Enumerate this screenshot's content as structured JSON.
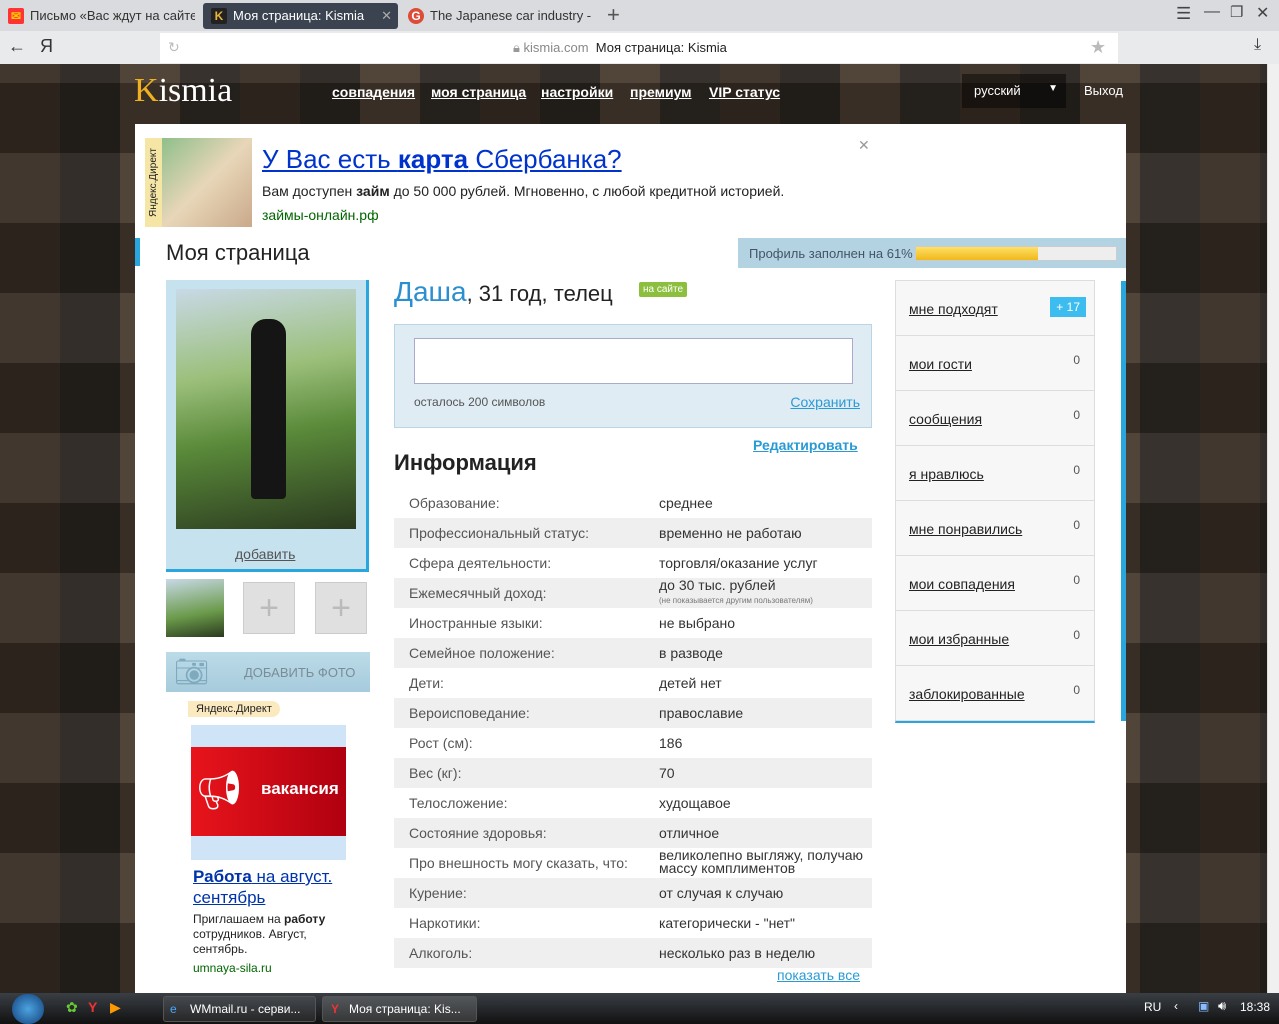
{
  "browser": {
    "tabs": [
      {
        "label": "Письмо «Вас ждут на сайте"
      },
      {
        "label": "Моя страница: Kismia"
      },
      {
        "label": "The Japanese car industry -"
      }
    ],
    "domain": "kismia.com",
    "page_title": "Моя страница: Kismia"
  },
  "header": {
    "logo": "Kismia",
    "nav": [
      "совпадения",
      "моя страница",
      "настройки",
      "премиум",
      "VIP статус"
    ],
    "language": "русский",
    "logout": "Выход"
  },
  "ad_top": {
    "label": "Яндекс.Директ",
    "title_pre": "У Вас есть ",
    "title_bold": "карта",
    "title_post": " Сбербанка?",
    "text_pre": "Вам доступен ",
    "text_bold": "займ",
    "text_post": " до 50 000 рублей. Мгновенно, с любой кредитной историей.",
    "url": "займы-онлайн.рф"
  },
  "page": {
    "title": "Моя страница",
    "profile_fill_label": "Профиль заполнен на 61%",
    "profile_fill": 0.61
  },
  "profile": {
    "name": "Даша",
    "details": ", 31 год, телец",
    "online": "на сайте",
    "add_link": "добавить",
    "add_photo": "ДОБАВИТЬ ФОТО",
    "status_remaining": "осталось 200 символов",
    "save": "Сохранить",
    "edit": "Редактировать",
    "info_title": "Информация",
    "show_all": "показать все",
    "info": [
      {
        "label": "Образование:",
        "value": "среднее"
      },
      {
        "label": "Профессиональный статус:",
        "value": "временно не работаю"
      },
      {
        "label": "Сфера деятельности:",
        "value": "торговля/оказание услуг"
      },
      {
        "label": "Ежемесячный доход:",
        "value": "до 30 тыс. рублей",
        "note": "(не показывается другим пользователям)"
      },
      {
        "label": "Иностранные языки:",
        "value": "не выбрано"
      },
      {
        "label": "Семейное положение:",
        "value": "в разводе"
      },
      {
        "label": "Дети:",
        "value": "детей нет"
      },
      {
        "label": "Вероисповедание:",
        "value": "православие"
      },
      {
        "label": "Рост (см):",
        "value": "186"
      },
      {
        "label": "Вес (кг):",
        "value": "70"
      },
      {
        "label": "Телосложение:",
        "value": "худощавое"
      },
      {
        "label": "Состояние здоровья:",
        "value": "отличное"
      },
      {
        "label": "Про внешность могу сказать, что:",
        "value": "великолепно выгляжу, получаю массу комплиментов"
      },
      {
        "label": "Курение:",
        "value": "от случая к случаю"
      },
      {
        "label": "Наркотики:",
        "value": "категорически - \"нет\""
      },
      {
        "label": "Алкоголь:",
        "value": "несколько раз в неделю"
      }
    ]
  },
  "sidebar": [
    {
      "label": "мне подходят",
      "count": "+ 17"
    },
    {
      "label": "мои гости",
      "count": "0"
    },
    {
      "label": "сообщения",
      "count": "0"
    },
    {
      "label": "я нравлюсь",
      "count": "0"
    },
    {
      "label": "мне понравились",
      "count": "0"
    },
    {
      "label": "мои совпадения",
      "count": "0"
    },
    {
      "label": "мои избранные",
      "count": "0"
    },
    {
      "label": "заблокированные",
      "count": "0"
    }
  ],
  "ad_left": {
    "label": "Яндекс.Директ",
    "banner": "вакансия",
    "title_bold": "Работа",
    "title_rest": " на август. сентябрь",
    "text_pre": "Приглашаем на ",
    "text_bold": "работу",
    "text_post": " сотрудников. Август, сентябрь.",
    "url": "umnaya-sila.ru"
  },
  "taskbar": {
    "items": [
      "WMmail.ru - серви...",
      "Моя страница: Kis..."
    ],
    "lang": "RU",
    "time": "18:38"
  }
}
